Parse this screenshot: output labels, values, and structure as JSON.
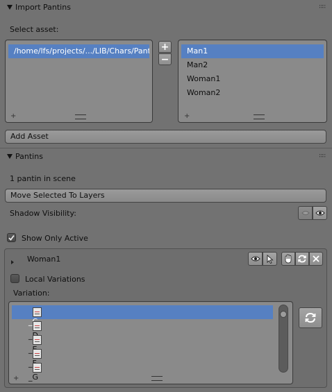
{
  "import_panel": {
    "title": "Import Pantins",
    "select_asset_label": "Select asset:",
    "paths": [
      "/home/lfs/projects/.../LIB/Chars/Pantins/"
    ],
    "assets": [
      "Man1",
      "Man2",
      "Woman1",
      "Woman2"
    ],
    "add_asset_label": "Add Asset",
    "plus_symbol": "+",
    "minus_symbol": "−",
    "small_plus_symbol": "+"
  },
  "pantins_panel": {
    "title": "Pantins",
    "count_text": "1 pantin in scene",
    "move_button_label": "Move Selected To Layers",
    "shadow_visibility_label": "Shadow Visibility:",
    "show_only_active_label": "Show Only Active",
    "show_only_active_checked": true
  },
  "pantin_box": {
    "name": "Woman1",
    "local_variations_label": "Local Variations",
    "local_variations_checked": false,
    "variation_label": "Variation:",
    "variations": [
      "_C",
      "_D",
      "_E",
      "_F",
      "_G"
    ],
    "selected_variation": "_C"
  },
  "colors": {
    "selection": "#5680c2",
    "background": "#727272"
  }
}
